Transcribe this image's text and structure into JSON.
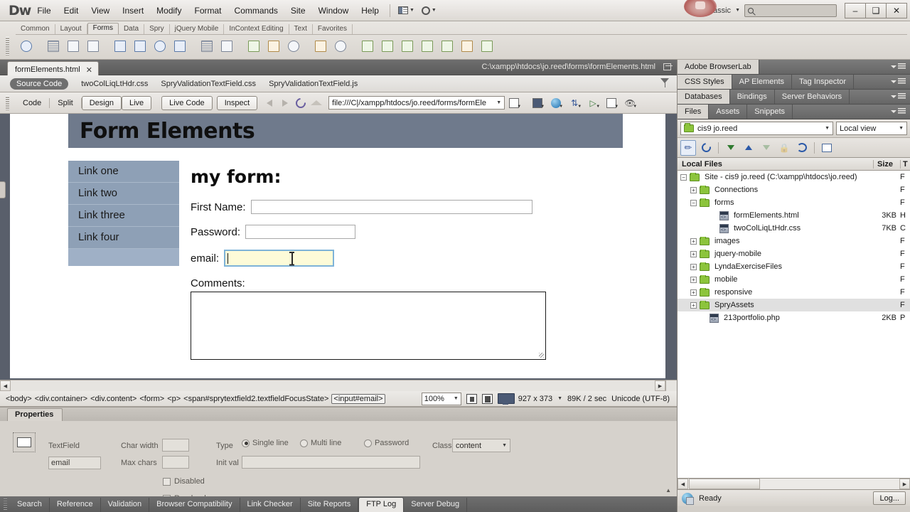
{
  "app": {
    "logo": "Dw",
    "workspace": "Classic",
    "menus": [
      "File",
      "Edit",
      "View",
      "Insert",
      "Modify",
      "Format",
      "Commands",
      "Site",
      "Window",
      "Help"
    ],
    "window_buttons": {
      "minimize": "–",
      "maximize": "❑",
      "close": "✕"
    },
    "search_placeholder": ""
  },
  "insert_bar": {
    "tabs": [
      "Common",
      "Layout",
      "Forms",
      "Data",
      "Spry",
      "jQuery Mobile",
      "InContext Editing",
      "Text",
      "Favorites"
    ],
    "active_tab": "Forms",
    "icons": [
      "form-icon",
      "text-field-icon",
      "hidden-field-icon",
      "textarea-icon",
      "checkbox-icon",
      "checkbox-group-icon",
      "radio-button-icon",
      "radio-group-icon",
      "select-list-icon",
      "jump-menu-icon",
      "image-field-icon",
      "file-field-icon",
      "button-icon",
      "label-icon",
      "fieldset-icon",
      "spry-validation-text-field-icon",
      "spry-validation-textarea-icon",
      "spry-validation-checkbox-icon",
      "spry-validation-select-icon",
      "spry-validation-password-icon",
      "spry-validation-confirm-icon",
      "spry-validation-radio-group-icon"
    ]
  },
  "document": {
    "tab_name": "formElements.html",
    "tab_close": "✕",
    "path": "C:\\xampp\\htdocs\\jo.reed\\forms\\formElements.html",
    "related_files": [
      "Source Code",
      "twoColLiqLtHdr.css",
      "SpryValidationTextField.css",
      "SpryValidationTextField.js"
    ],
    "related_active": "Source Code"
  },
  "doc_toolbar": {
    "view_buttons": [
      "Code",
      "Split",
      "Design",
      "Live"
    ],
    "active_view": "Design",
    "live_code_label": "Live Code",
    "inspect_label": "Inspect",
    "address": "file:///C|/xampp/htdocs/jo.reed/forms/formEle",
    "icons": [
      "back-arrow-icon",
      "forward-arrow-icon",
      "refresh-icon",
      "home-icon",
      "view-options-icon",
      "multiscreen-icon",
      "preview-browser-icon",
      "file-management-icon",
      "check-browser-icon",
      "validate-icon",
      "visual-aids-icon"
    ]
  },
  "page": {
    "header_title": "Form Elements",
    "nav_links": [
      "Link one",
      "Link two",
      "Link three",
      "Link four"
    ],
    "form_heading": "my form:",
    "fields": [
      {
        "label": "First Name:",
        "value": "",
        "type": "text"
      },
      {
        "label": "Password:",
        "value": "",
        "type": "text"
      },
      {
        "label": "email:",
        "value": "",
        "type": "text",
        "focused": true
      }
    ],
    "comments_label": "Comments:",
    "comments_value": ""
  },
  "status_bar": {
    "tags": [
      "<body>",
      "<div.container>",
      "<div.content>",
      "<form>",
      "<p>",
      "<span#sprytextfield2.textfieldFocusState>",
      "<input#email>"
    ],
    "selected_tag": "<input#email>",
    "zoom": "100%",
    "window_size": "927 x 373",
    "download": "89K / 2 sec",
    "encoding": "Unicode (UTF-8)"
  },
  "properties": {
    "panel_title": "Properties",
    "textfield_label": "TextField",
    "textfield_name": "email",
    "char_width_label": "Char width",
    "char_width_value": "",
    "max_chars_label": "Max chars",
    "max_chars_value": "",
    "type_label": "Type",
    "type_options": [
      "Single line",
      "Multi line",
      "Password"
    ],
    "type_selected": "Single line",
    "init_val_label": "Init val",
    "init_val_value": "",
    "class_label": "Class",
    "class_value": "content",
    "disabled_label": "Disabled",
    "readonly_label": "Read-only"
  },
  "results_tabs": {
    "items": [
      "Search",
      "Reference",
      "Validation",
      "Browser Compatibility",
      "Link Checker",
      "Site Reports",
      "FTP Log",
      "Server Debug"
    ],
    "active": "FTP Log"
  },
  "right_panel": {
    "groups": [
      {
        "tabs": [
          "Adobe BrowserLab"
        ],
        "active": "Adobe BrowserLab"
      },
      {
        "tabs": [
          "CSS Styles",
          "AP Elements",
          "Tag Inspector"
        ],
        "active": "CSS Styles"
      },
      {
        "tabs": [
          "Databases",
          "Bindings",
          "Server Behaviors"
        ],
        "active": "Databases"
      },
      {
        "tabs": [
          "Files",
          "Assets",
          "Snippets"
        ],
        "active": "Files"
      }
    ],
    "site_name": "cis9 jo.reed",
    "view_mode": "Local view",
    "toolbar_icons": [
      "connect-icon",
      "refresh-icon",
      "get-files-icon",
      "put-files-icon",
      "check-out-icon",
      "check-in-icon",
      "synchronize-icon",
      "expand-icon"
    ],
    "columns": {
      "name": "Local Files",
      "size": "Size",
      "type": "T"
    },
    "tree": [
      {
        "indent": 0,
        "toggle": "minus",
        "icon": "folder",
        "name": "Site - cis9 jo.reed (C:\\xampp\\htdocs\\jo.reed)",
        "size": "",
        "type": "F",
        "selected": false
      },
      {
        "indent": 1,
        "toggle": "plus",
        "icon": "folder",
        "name": "Connections",
        "size": "",
        "type": "F",
        "selected": false
      },
      {
        "indent": 1,
        "toggle": "minus",
        "icon": "folder",
        "name": "forms",
        "size": "",
        "type": "F",
        "selected": false
      },
      {
        "indent": 3,
        "toggle": "none",
        "icon": "file",
        "name": "formElements.html",
        "size": "3KB",
        "type": "H",
        "selected": false
      },
      {
        "indent": 3,
        "toggle": "none",
        "icon": "file",
        "name": "twoColLiqLtHdr.css",
        "size": "7KB",
        "type": "C",
        "selected": false
      },
      {
        "indent": 1,
        "toggle": "plus",
        "icon": "folder",
        "name": "images",
        "size": "",
        "type": "F",
        "selected": false
      },
      {
        "indent": 1,
        "toggle": "plus",
        "icon": "folder",
        "name": "jquery-mobile",
        "size": "",
        "type": "F",
        "selected": false
      },
      {
        "indent": 1,
        "toggle": "plus",
        "icon": "folder",
        "name": "LyndaExerciseFiles",
        "size": "",
        "type": "F",
        "selected": false
      },
      {
        "indent": 1,
        "toggle": "plus",
        "icon": "folder",
        "name": "mobile",
        "size": "",
        "type": "F",
        "selected": false
      },
      {
        "indent": 1,
        "toggle": "plus",
        "icon": "folder",
        "name": "responsive",
        "size": "",
        "type": "F",
        "selected": false
      },
      {
        "indent": 1,
        "toggle": "plus",
        "icon": "folder",
        "name": "SpryAssets",
        "size": "",
        "type": "F",
        "selected": true
      },
      {
        "indent": 2,
        "toggle": "none",
        "icon": "file",
        "name": "213portfolio.php",
        "size": "2KB",
        "type": "P",
        "selected": false
      }
    ],
    "status_text": "Ready",
    "log_button": "Log..."
  }
}
